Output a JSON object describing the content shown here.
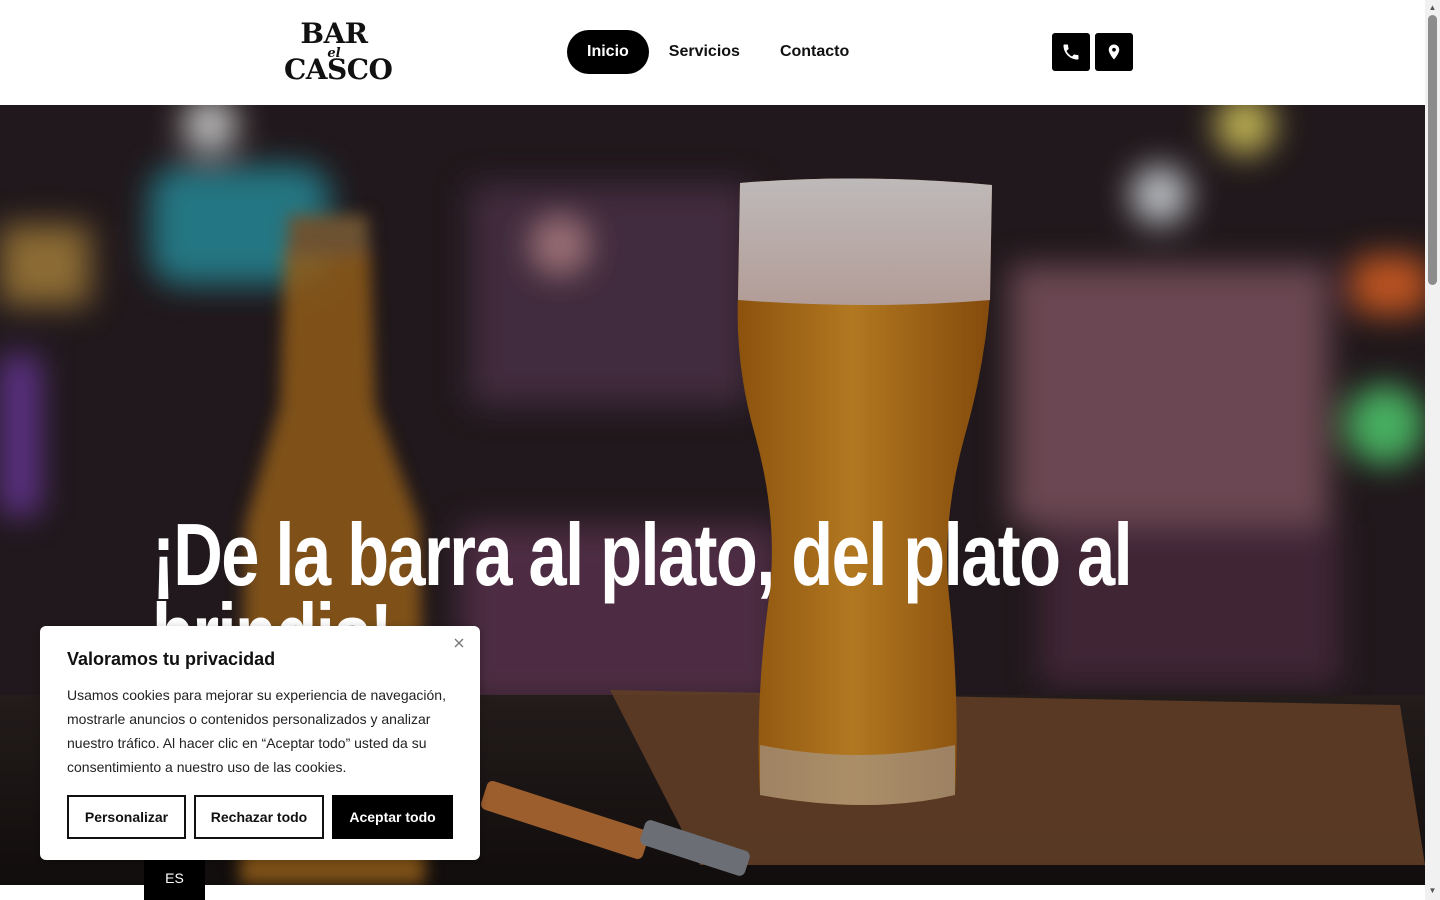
{
  "logo": {
    "line1": "BAR",
    "line2": "el",
    "line3": "CASCO"
  },
  "nav": {
    "items": [
      "Inicio",
      "Servicios",
      "Contacto"
    ],
    "active": "Inicio"
  },
  "header_icons": [
    "phone-icon",
    "map-pin-icon"
  ],
  "hero": {
    "title": "¡De la barra al plato, del plato al brindis!"
  },
  "cookie": {
    "title": "Valoramos tu privacidad",
    "body": "Usamos cookies para mejorar su experiencia de navegación, mostrarle anuncios o contenidos personalizados y analizar nuestro tráfico. Al hacer clic en “Aceptar todo” usted da su consentimiento a nuestro uso de las cookies.",
    "buttons": {
      "customize": "Personalizar",
      "reject": "Rechazar todo",
      "accept": "Aceptar todo"
    }
  },
  "language": "ES",
  "colors": {
    "primary": "#000000",
    "background": "#ffffff",
    "hero_text": "#ffffff"
  }
}
